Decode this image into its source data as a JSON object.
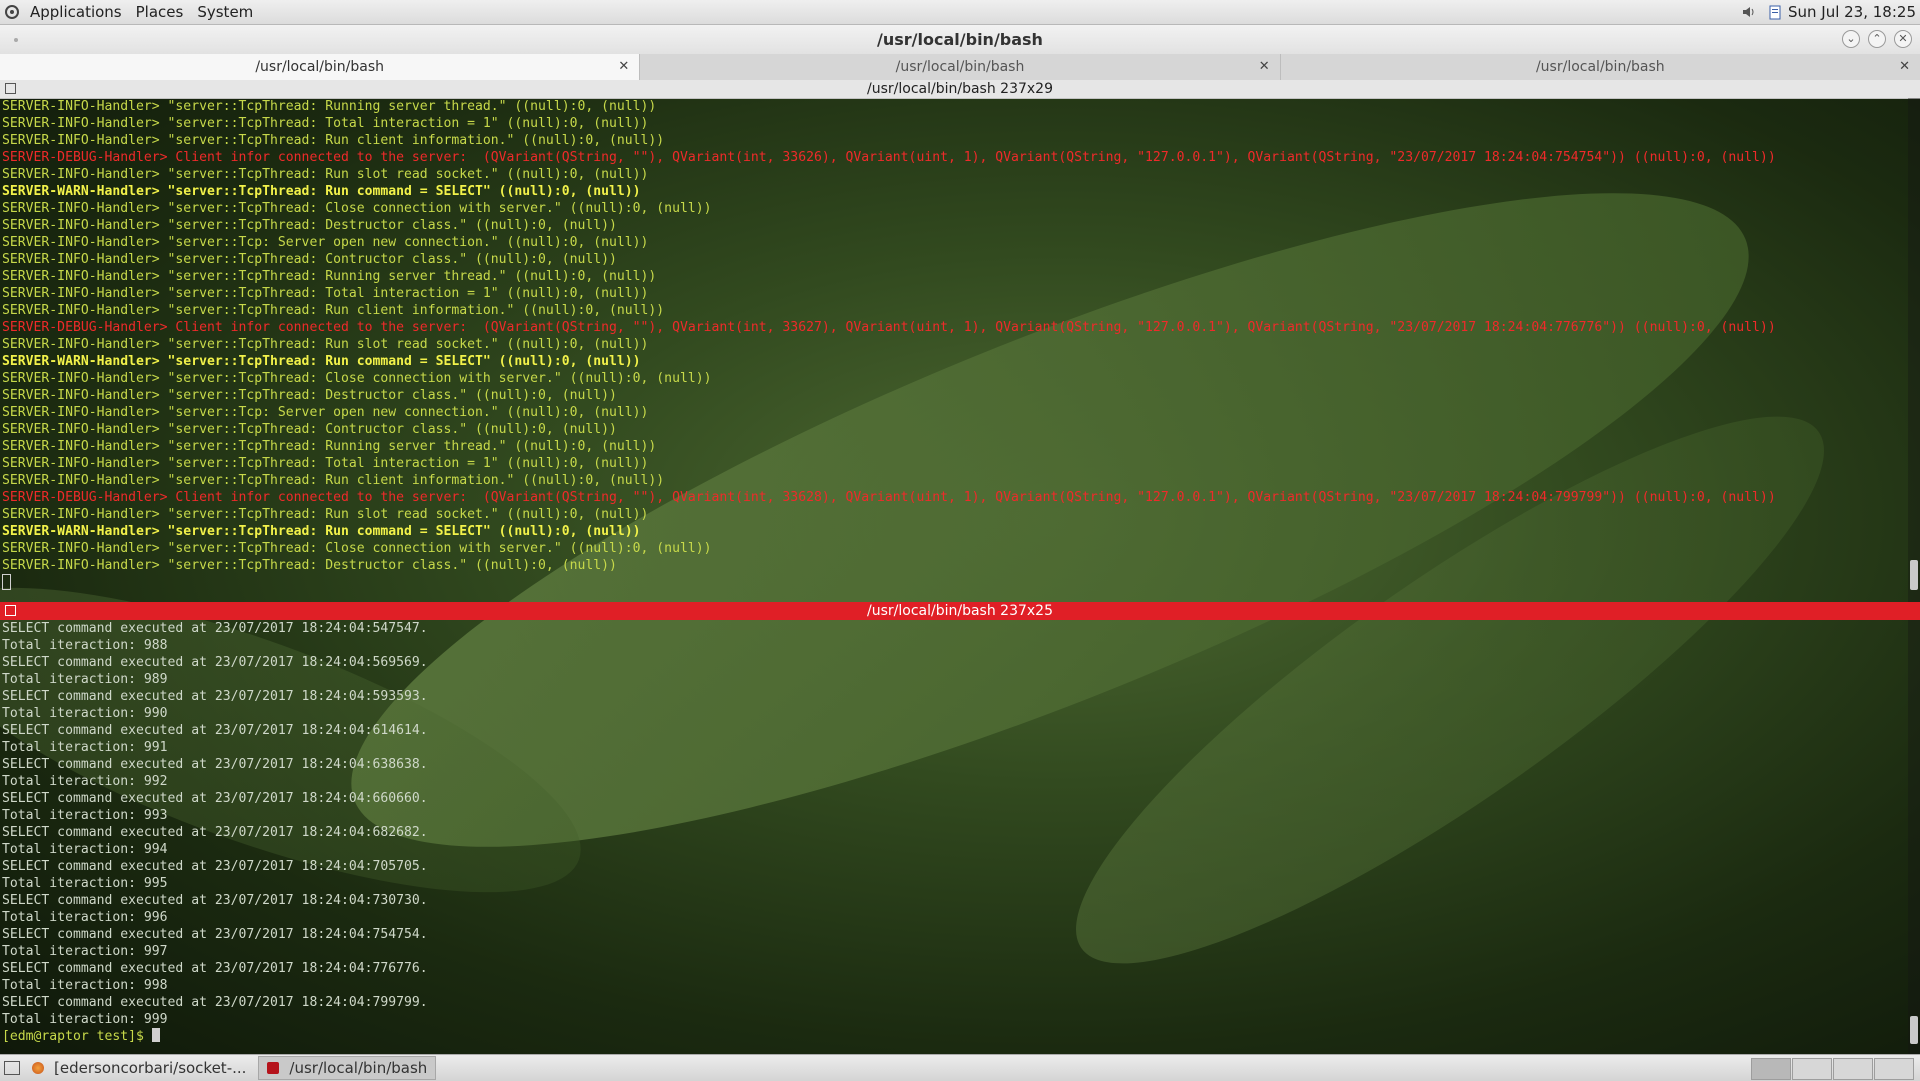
{
  "top_panel": {
    "menus": [
      "Applications",
      "Places",
      "System"
    ],
    "clock": "Sun Jul 23, 18:25"
  },
  "window": {
    "title": "/usr/local/bin/bash"
  },
  "tabs": [
    {
      "label": "/usr/local/bin/bash",
      "active": true
    },
    {
      "label": "/usr/local/bin/bash",
      "active": false
    },
    {
      "label": "/usr/local/bin/bash",
      "active": false
    }
  ],
  "pane_top": {
    "header": "/usr/local/bin/bash 237x29",
    "lines": [
      {
        "level": "info",
        "text": "SERVER-INFO-Handler> \"server::TcpThread: Running server thread.\" ((null):0, (null))"
      },
      {
        "level": "info",
        "text": "SERVER-INFO-Handler> \"server::TcpThread: Total interaction = 1\" ((null):0, (null))"
      },
      {
        "level": "info",
        "text": "SERVER-INFO-Handler> \"server::TcpThread: Run client information.\" ((null):0, (null))"
      },
      {
        "level": "debug",
        "text": "SERVER-DEBUG-Handler> Client infor connected to the server:  (QVariant(QString, \"\"), QVariant(int, 33626), QVariant(uint, 1), QVariant(QString, \"127.0.0.1\"), QVariant(QString, \"23/07/2017 18:24:04:754754\")) ((null):0, (null))"
      },
      {
        "level": "info",
        "text": "SERVER-INFO-Handler> \"server::TcpThread: Run slot read socket.\" ((null):0, (null))"
      },
      {
        "level": "warn",
        "text": "SERVER-WARN-Handler> \"server::TcpThread: Run command = SELECT\" ((null):0, (null))"
      },
      {
        "level": "info",
        "text": "SERVER-INFO-Handler> \"server::TcpThread: Close connection with server.\" ((null):0, (null))"
      },
      {
        "level": "info",
        "text": "SERVER-INFO-Handler> \"server::TcpThread: Destructor class.\" ((null):0, (null))"
      },
      {
        "level": "info",
        "text": "SERVER-INFO-Handler> \"server::Tcp: Server open new connection.\" ((null):0, (null))"
      },
      {
        "level": "info",
        "text": "SERVER-INFO-Handler> \"server::TcpThread: Contructor class.\" ((null):0, (null))"
      },
      {
        "level": "info",
        "text": "SERVER-INFO-Handler> \"server::TcpThread: Running server thread.\" ((null):0, (null))"
      },
      {
        "level": "info",
        "text": "SERVER-INFO-Handler> \"server::TcpThread: Total interaction = 1\" ((null):0, (null))"
      },
      {
        "level": "info",
        "text": "SERVER-INFO-Handler> \"server::TcpThread: Run client information.\" ((null):0, (null))"
      },
      {
        "level": "debug",
        "text": "SERVER-DEBUG-Handler> Client infor connected to the server:  (QVariant(QString, \"\"), QVariant(int, 33627), QVariant(uint, 1), QVariant(QString, \"127.0.0.1\"), QVariant(QString, \"23/07/2017 18:24:04:776776\")) ((null):0, (null))"
      },
      {
        "level": "info",
        "text": "SERVER-INFO-Handler> \"server::TcpThread: Run slot read socket.\" ((null):0, (null))"
      },
      {
        "level": "warn",
        "text": "SERVER-WARN-Handler> \"server::TcpThread: Run command = SELECT\" ((null):0, (null))"
      },
      {
        "level": "info",
        "text": "SERVER-INFO-Handler> \"server::TcpThread: Close connection with server.\" ((null):0, (null))"
      },
      {
        "level": "info",
        "text": "SERVER-INFO-Handler> \"server::TcpThread: Destructor class.\" ((null):0, (null))"
      },
      {
        "level": "info",
        "text": "SERVER-INFO-Handler> \"server::Tcp: Server open new connection.\" ((null):0, (null))"
      },
      {
        "level": "info",
        "text": "SERVER-INFO-Handler> \"server::TcpThread: Contructor class.\" ((null):0, (null))"
      },
      {
        "level": "info",
        "text": "SERVER-INFO-Handler> \"server::TcpThread: Running server thread.\" ((null):0, (null))"
      },
      {
        "level": "info",
        "text": "SERVER-INFO-Handler> \"server::TcpThread: Total interaction = 1\" ((null):0, (null))"
      },
      {
        "level": "info",
        "text": "SERVER-INFO-Handler> \"server::TcpThread: Run client information.\" ((null):0, (null))"
      },
      {
        "level": "debug",
        "text": "SERVER-DEBUG-Handler> Client infor connected to the server:  (QVariant(QString, \"\"), QVariant(int, 33628), QVariant(uint, 1), QVariant(QString, \"127.0.0.1\"), QVariant(QString, \"23/07/2017 18:24:04:799799\")) ((null):0, (null))"
      },
      {
        "level": "info",
        "text": "SERVER-INFO-Handler> \"server::TcpThread: Run slot read socket.\" ((null):0, (null))"
      },
      {
        "level": "warn",
        "text": "SERVER-WARN-Handler> \"server::TcpThread: Run command = SELECT\" ((null):0, (null))"
      },
      {
        "level": "info",
        "text": "SERVER-INFO-Handler> \"server::TcpThread: Close connection with server.\" ((null):0, (null))"
      },
      {
        "level": "info",
        "text": "SERVER-INFO-Handler> \"server::TcpThread: Destructor class.\" ((null):0, (null))"
      }
    ]
  },
  "pane_bottom": {
    "header": "/usr/local/bin/bash 237x25",
    "lines": [
      "SELECT command executed at 23/07/2017 18:24:04:547547.",
      "Total iteraction: 988",
      "SELECT command executed at 23/07/2017 18:24:04:569569.",
      "Total iteraction: 989",
      "SELECT command executed at 23/07/2017 18:24:04:593593.",
      "Total iteraction: 990",
      "SELECT command executed at 23/07/2017 18:24:04:614614.",
      "Total iteraction: 991",
      "SELECT command executed at 23/07/2017 18:24:04:638638.",
      "Total iteraction: 992",
      "SELECT command executed at 23/07/2017 18:24:04:660660.",
      "Total iteraction: 993",
      "SELECT command executed at 23/07/2017 18:24:04:682682.",
      "Total iteraction: 994",
      "SELECT command executed at 23/07/2017 18:24:04:705705.",
      "Total iteraction: 995",
      "SELECT command executed at 23/07/2017 18:24:04:730730.",
      "Total iteraction: 996",
      "SELECT command executed at 23/07/2017 18:24:04:754754.",
      "Total iteraction: 997",
      "SELECT command executed at 23/07/2017 18:24:04:776776.",
      "Total iteraction: 998",
      "SELECT command executed at 23/07/2017 18:24:04:799799.",
      "Total iteraction: 999"
    ],
    "prompt": "[edm@raptor test]$ "
  },
  "taskbar": {
    "items": [
      {
        "label": "[edersoncorbari/socket-...",
        "icon": "firefox-icon",
        "active": false
      },
      {
        "label": "/usr/local/bin/bash",
        "icon": "terminal-icon",
        "active": true
      }
    ]
  },
  "colors": {
    "info": "#c7d94a",
    "warn": "#f2f24a",
    "debug": "#ef2a2a",
    "active_header": "#e01f26"
  }
}
